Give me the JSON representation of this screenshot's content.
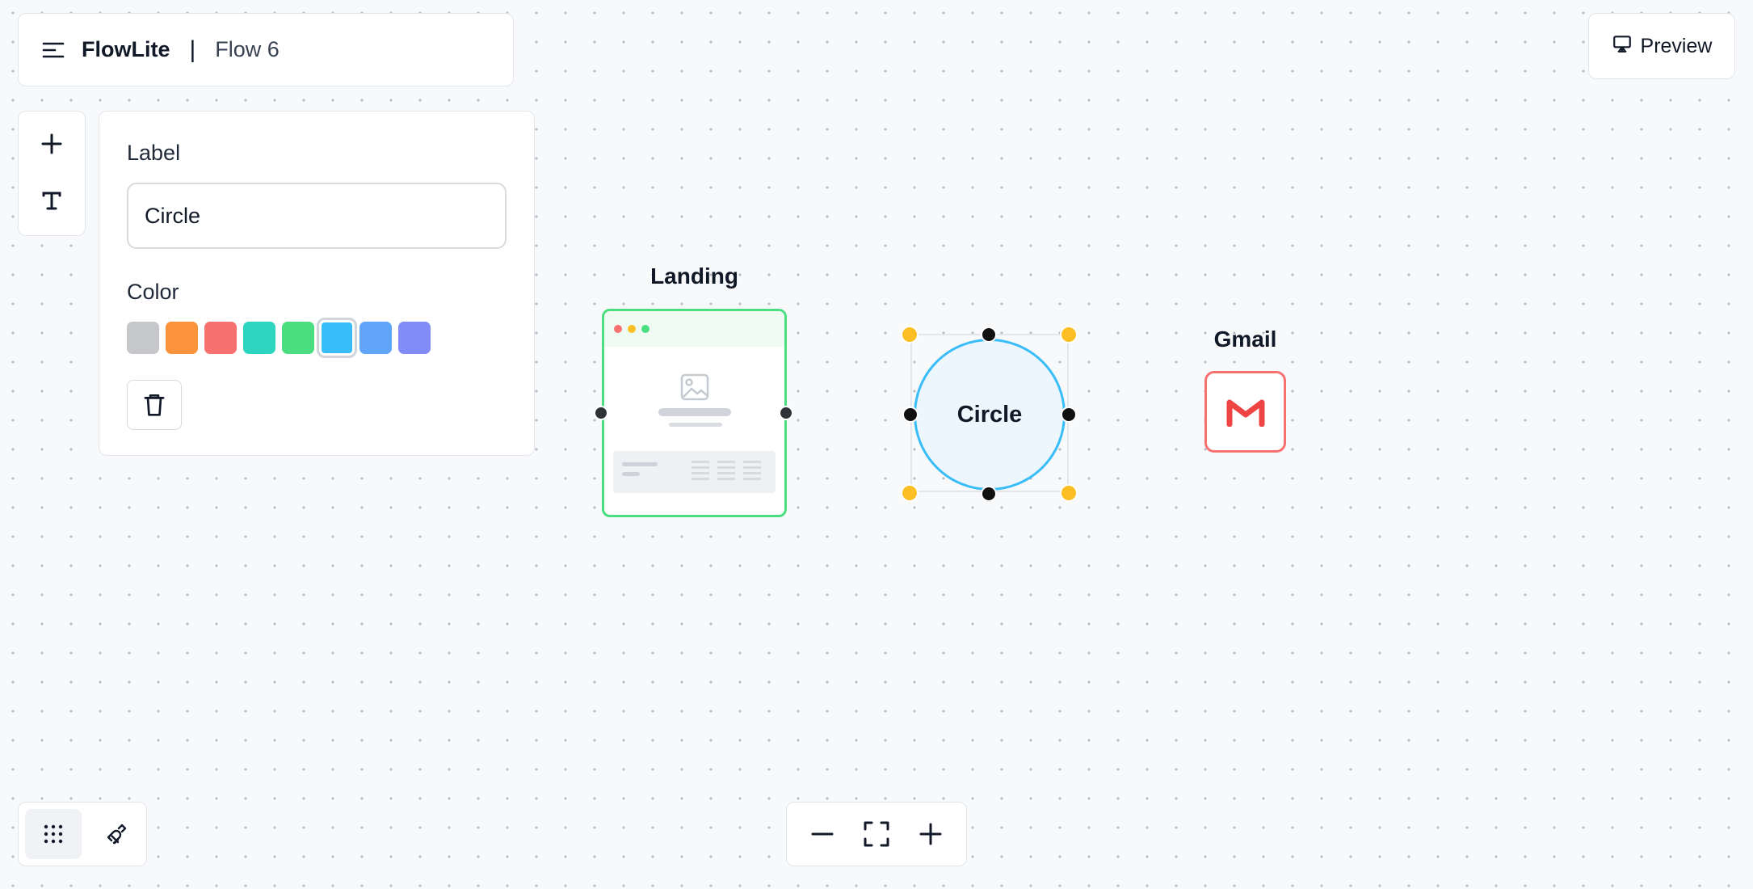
{
  "header": {
    "app_name": "FlowLite",
    "separator": "|",
    "flow_name": "Flow 6"
  },
  "preview": {
    "label": "Preview"
  },
  "tools": [
    {
      "icon": "plus-icon"
    },
    {
      "icon": "text-icon"
    }
  ],
  "properties": {
    "label_heading": "Label",
    "label_value": "Circle",
    "color_heading": "Color",
    "colors": [
      "#c5c7cb",
      "#fb923c",
      "#f87171",
      "#2dd4bf",
      "#4ade80",
      "#38bdf8",
      "#60a5fa",
      "#818cf8"
    ],
    "selected_color": "#38bdf8"
  },
  "nodes": {
    "landing": {
      "title": "Landing",
      "border_color": "#4ade80"
    },
    "circle": {
      "label": "Circle",
      "border_color": "#38bdf8",
      "fill": "#eef6fd"
    },
    "gmail": {
      "title": "Gmail",
      "border_color": "#f87171"
    }
  },
  "bottom_left": [
    {
      "icon": "grid-dots-icon",
      "active": true
    },
    {
      "icon": "magnet-icon",
      "active": false
    }
  ],
  "zoom_controls": [
    {
      "icon": "zoom-out-icon"
    },
    {
      "icon": "fit-view-icon"
    },
    {
      "icon": "zoom-in-icon"
    }
  ]
}
